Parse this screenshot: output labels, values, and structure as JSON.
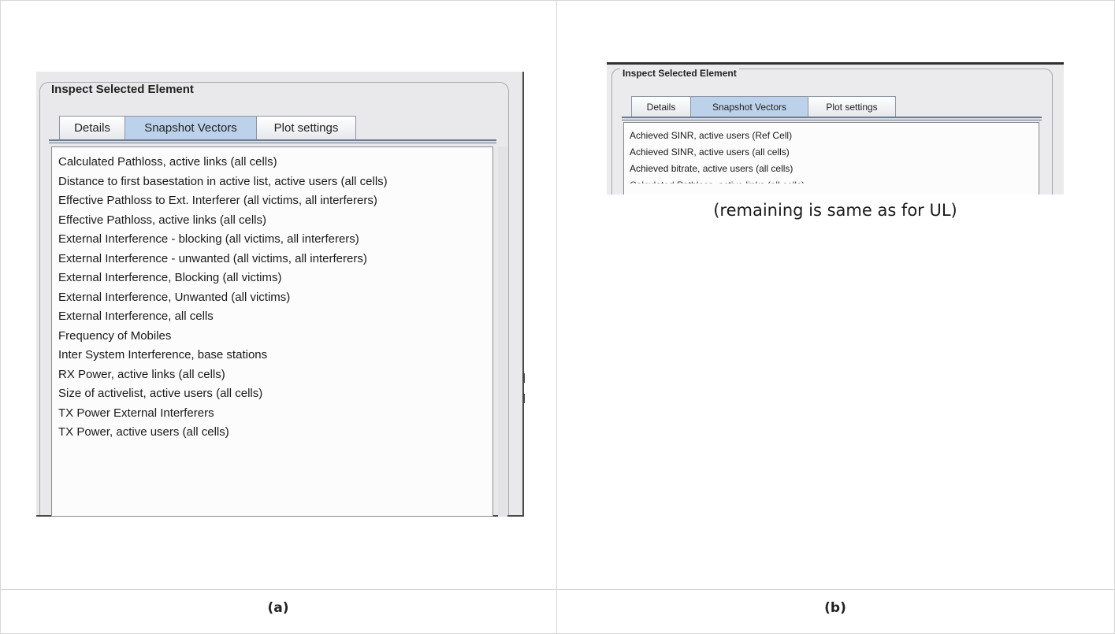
{
  "panel_a": {
    "group_title": "Inspect Selected Element",
    "tabs": [
      {
        "label": "Details",
        "selected": false
      },
      {
        "label": "Snapshot Vectors",
        "selected": true
      },
      {
        "label": "Plot settings",
        "selected": false
      }
    ],
    "items": [
      "Calculated Pathloss, active links (all cells)",
      "Distance to first basestation in active list, active users (all cells)",
      "Effective Pathloss to Ext. Interferer (all victims, all interferers)",
      "Effective Pathloss, active links (all cells)",
      "External Interference - blocking (all victims, all interferers)",
      "External Interference - unwanted (all victims, all interferers)",
      "External Interference, Blocking (all victims)",
      "External Interference, Unwanted (all victims)",
      "External Interference, all cells",
      "Frequency of Mobiles",
      "Inter System Interference, base stations",
      "RX Power, active links (all cells)",
      "Size of activelist, active users (all cells)",
      "TX Power External Interferers",
      "TX Power, active users (all cells)"
    ]
  },
  "panel_b": {
    "group_title": "Inspect Selected Element",
    "tabs": [
      {
        "label": "Details",
        "selected": false
      },
      {
        "label": "Snapshot Vectors",
        "selected": true
      },
      {
        "label": "Plot settings",
        "selected": false
      }
    ],
    "items": [
      "Achieved SINR, active users (Ref Cell)",
      "Achieved SINR, active users (all cells)",
      "Achieved bitrate, active users (all cells)",
      "Calculated Pathloss, active links (all cells)"
    ],
    "note": "(remaining is same as for UL)"
  },
  "captions": {
    "a": "(a)",
    "b": "(b)"
  },
  "colors": {
    "selected_tab": "#bcd1ea",
    "panel_bg": "#e9e9eb",
    "list_bg": "#fcfcfd"
  }
}
